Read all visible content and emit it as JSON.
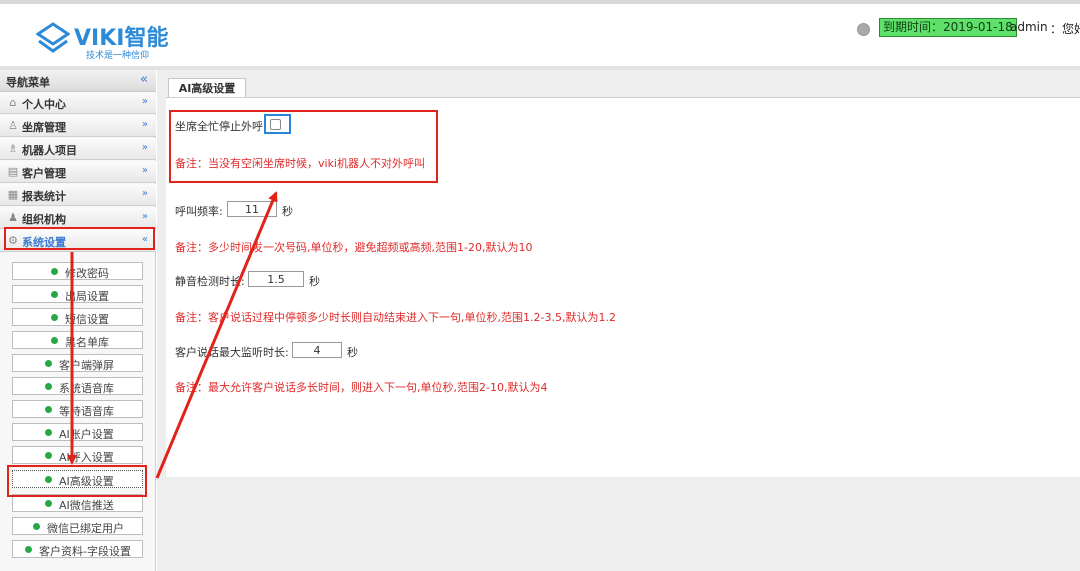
{
  "header": {
    "logo_text": "VIKI智能",
    "logo_slogan": "技术是一种信仰",
    "expire": "到期时间：2019-01-18",
    "user": "admin",
    "greeting": "：您好"
  },
  "sidebar": {
    "title": "导航菜单",
    "collapse": "«",
    "menus": [
      {
        "label": "个人中心",
        "icon": "home-icon",
        "chevron": "»"
      },
      {
        "label": "坐席管理",
        "icon": "user-icon",
        "chevron": "»"
      },
      {
        "label": "机器人项目",
        "icon": "users-icon",
        "chevron": "»"
      },
      {
        "label": "客户管理",
        "icon": "folder-icon",
        "chevron": "»"
      },
      {
        "label": "报表统计",
        "icon": "report-icon",
        "chevron": "»"
      },
      {
        "label": "组织机构",
        "icon": "org-icon",
        "chevron": "»"
      },
      {
        "label": "系统设置",
        "icon": "gear-icon",
        "chevron": "«"
      }
    ],
    "subitems": [
      "修改密码",
      "出局设置",
      "短信设置",
      "黑名单库",
      "客户端弹屏",
      "系统语音库",
      "等待语音库",
      "AI账户设置",
      "AI呼入设置",
      "AI高级设置",
      "AI微信推送",
      "微信已绑定用户",
      "客户资料-字段设置"
    ]
  },
  "main": {
    "tab": "AI高级设置",
    "busy_label": "坐席全忙停止外呼:",
    "busy_note": "备注：当没有空闲坐席时候，viki机器人不对外呼叫",
    "freq_label": "呼叫频率:",
    "freq_value": "11",
    "freq_unit": "秒",
    "freq_note": "备注：多少时间发一次号码,单位秒，避免超频或高频,范围1-20,默认为10",
    "silence_label": "静音检测时长:",
    "silence_value": "1.5",
    "silence_unit": "秒",
    "silence_note": "备注：客户说话过程中停顿多少时长则自动结束进入下一句,单位秒,范围1.2-3.5,默认为1.2",
    "listen_label": "客户说话最大监听时长:",
    "listen_value": "4",
    "listen_unit": "秒",
    "listen_note": "备注：最大允许客户说话多长时间，则进入下一句,单位秒,范围2-10,默认为4"
  },
  "colors": {
    "brand": "#2d8ad6",
    "annotation_red": "#e2231a",
    "annotation_blue": "#2a86d6",
    "note_red": "#e12b2b",
    "expire_green": "#5ee06a",
    "dot_green": "#28a745"
  }
}
